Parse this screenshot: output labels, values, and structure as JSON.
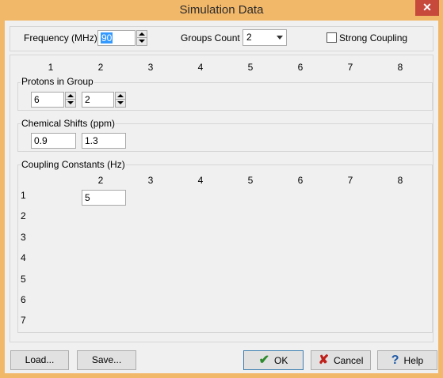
{
  "window": {
    "title": "Simulation Data",
    "close_glyph": "✕"
  },
  "top": {
    "frequency_label": "Frequency (MHz) :",
    "frequency_value": "90",
    "groups_count_label": "Groups Count :",
    "groups_count_value": "2",
    "strong_coupling_label": "Strong Coupling",
    "strong_coupling_checked": false
  },
  "column_numbers": [
    "1",
    "2",
    "3",
    "4",
    "5",
    "6",
    "7",
    "8"
  ],
  "protons": {
    "label": "Protons in Group",
    "values": [
      "6",
      "2"
    ]
  },
  "shifts": {
    "label": "Chemical Shifts (ppm)",
    "values": [
      "0.9",
      "1.3"
    ]
  },
  "coupling": {
    "label": "Coupling Constants (Hz)",
    "col_numbers": [
      "2",
      "3",
      "4",
      "5",
      "6",
      "7",
      "8"
    ],
    "row_numbers": [
      "1",
      "2",
      "3",
      "4",
      "5",
      "6",
      "7"
    ],
    "value_1_2": "5"
  },
  "buttons": {
    "load": "Load...",
    "save": "Save...",
    "ok": "OK",
    "cancel": "Cancel",
    "help": "Help"
  },
  "icons": {
    "ok": "check-icon",
    "cancel": "x-icon",
    "help": "question-icon"
  },
  "colors": {
    "title_bar": "#f2b86a",
    "close": "#c7493c",
    "ok_check": "#2e8b2e",
    "cancel_x": "#c0201a",
    "help_q": "#1e5aa8"
  }
}
